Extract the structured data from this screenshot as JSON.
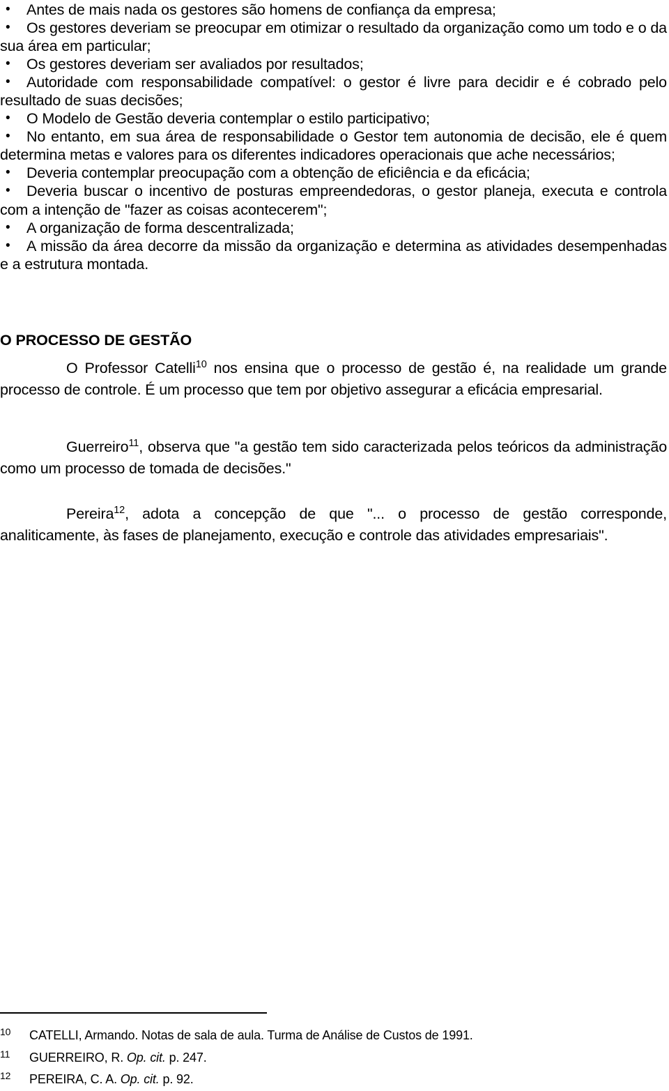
{
  "document": {
    "bullets": [
      "Antes de mais nada os gestores são homens de confiança da empresa;",
      "Os gestores deveriam se preocupar em otimizar o resultado da organização como um todo e o da sua área em particular;",
      "Os gestores deveriam ser avaliados por resultados;",
      "Autoridade com responsabilidade compatível: o gestor é livre para decidir e é cobrado pelo resultado de suas decisões;",
      "O Modelo de Gestão deveria contemplar o estilo participativo;",
      "No entanto, em sua área de responsabilidade o Gestor tem autonomia de decisão, ele é quem determina metas e valores para os diferentes indicadores operacionais que ache necessários;",
      "Deveria contemplar preocupação com a obtenção de eficiência e da eficácia;",
      "Deveria buscar o incentivo de posturas empreendedoras, o gestor planeja, executa e controla com a intenção de \"fazer as coisas acontecerem\";",
      "A organização de forma descentralizada;",
      "A missão da área decorre da missão da organização e determina as atividades desempenhadas e a estrutura montada."
    ],
    "bullet_glyph": "•",
    "heading": "O PROCESSO DE GESTÃO",
    "paragraphs": [
      {
        "id": "catelli",
        "before": "O Professor Catelli",
        "note": "10",
        "after": " nos ensina que o processo de gestão é, na realidade um grande processo de controle. É um processo que tem por objetivo assegurar a eficácia empresarial."
      },
      {
        "id": "guerreiro",
        "before": "Guerreiro",
        "note": "11",
        "after": ", observa que \"a gestão tem sido caracterizada pelos teóricos da administração como um processo de tomada de decisões.\""
      },
      {
        "id": "pereira",
        "before": "Pereira",
        "note": "12",
        "after": ", adota a concepção de que \"... o processo de gestão corresponde, analiticamente, às fases de planejamento, execução e controle das atividades empresariais\"."
      }
    ],
    "footnotes": [
      {
        "number": "10",
        "pre": "CATELLI, Armando. Notas de sala de aula. Turma de Análise de Custos de 1991.",
        "italic": "",
        "post": ""
      },
      {
        "number": "11",
        "pre": "GUERREIRO, R. ",
        "italic": "Op. cit.",
        "post": " p. 247."
      },
      {
        "number": "12",
        "pre": "PEREIRA, C. A. ",
        "italic": "Op. cit.",
        "post": " p. 92."
      }
    ]
  }
}
